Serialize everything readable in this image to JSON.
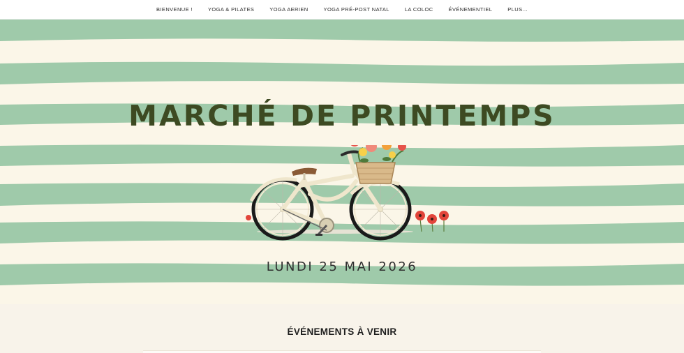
{
  "nav": {
    "items": [
      {
        "label": "BIENVENUE !"
      },
      {
        "label": "YOGA & PILATES"
      },
      {
        "label": "YOGA AERIEN"
      },
      {
        "label": "YOGA PRÉ-POST NATAL"
      },
      {
        "label": "LA COLOC"
      },
      {
        "label": "ÉVÉNEMENTIEL"
      },
      {
        "label": "PLUS..."
      }
    ]
  },
  "hero": {
    "title": "MARCHÉ DE PRINTEMPS",
    "date": "LUNDI 25 MAI 2026",
    "colors": {
      "stripe_green": "#9fcaaa",
      "stripe_cream": "#fbf6e8",
      "title": "#3d4a22"
    },
    "illustration": "bicycle-with-flower-basket-icon"
  },
  "events": {
    "title": "ÉVÉNEMENTS À VENIR"
  }
}
